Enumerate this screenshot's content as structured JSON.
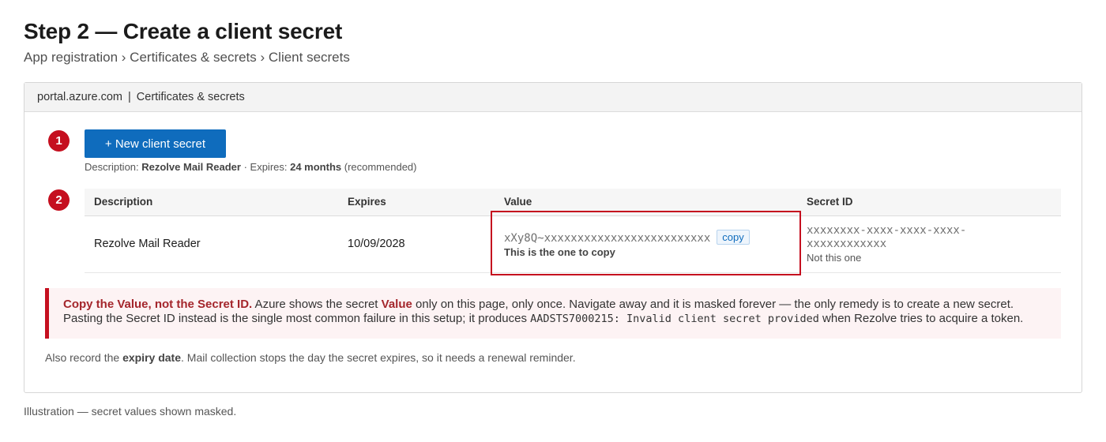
{
  "page": {
    "title": "Step 2 — Create a client secret",
    "breadcrumb": "App registration › Certificates & secrets › Client secrets"
  },
  "panel": {
    "header_host": "portal.azure.com",
    "header_sep": "|",
    "header_section": "Certificates & secrets"
  },
  "step1": {
    "badge": "1",
    "button_label": "+ New client secret",
    "desc_prefix": "Description: ",
    "desc_value": "Rezolve Mail Reader",
    "desc_sep": " · ",
    "expires_prefix": "Expires: ",
    "expires_value": "24 months",
    "expires_suffix": " (recommended)"
  },
  "step2": {
    "badge": "2",
    "columns": [
      "Description",
      "Expires",
      "Value",
      "Secret ID"
    ],
    "row": {
      "description": "Rezolve Mail Reader",
      "expires": "10/09/2028",
      "value": "xXy8Q~xxxxxxxxxxxxxxxxxxxxxxxxx",
      "copy_label": "copy",
      "value_hint": "This is the one to copy",
      "secret_id_line1": "xxxxxxxx-xxxx-xxxx-xxxx-",
      "secret_id_line2": "xxxxxxxxxxxx",
      "secret_id_hint": "Not this one"
    }
  },
  "warning": {
    "lead": "Copy the Value, not the Secret ID.",
    "t1": " Azure shows the secret ",
    "value_word": "Value",
    "t2": " only on this page, only once. Navigate away and it is masked forever — the only remedy is to create a new secret. Pasting the Secret ID instead is the single most common failure in this setup; it produces ",
    "error_code": "AADSTS7000215: Invalid client secret provided",
    "t3": " when Rezolve tries to acquire a token."
  },
  "expiry_note": {
    "prefix": "Also record the ",
    "bold": "expiry date",
    "suffix": ". Mail collection stops the day the secret expires, so it needs a renewal reminder."
  },
  "footnote": "Illustration — secret values shown masked.",
  "colors": {
    "accent_red": "#c50f1f",
    "button_blue": "#0f6cbd"
  }
}
